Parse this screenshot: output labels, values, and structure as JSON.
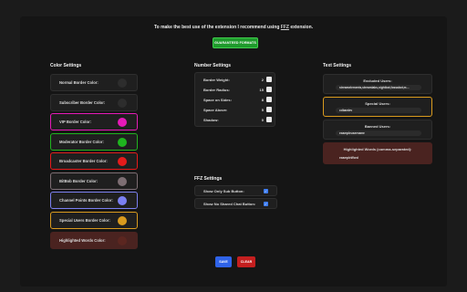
{
  "header": {
    "note_prefix": "To make the best use of the extension I recommend using",
    "note_link": "FFZ",
    "note_suffix": "extension.",
    "generate_button": "GUARANTEED FORMATS"
  },
  "color_settings": {
    "title": "Color Settings",
    "rows": [
      {
        "label": "Normal Border Color:",
        "color": "#2d2d2d",
        "border": "#2e2e2e",
        "bg": "#1f1f1f"
      },
      {
        "label": "Subscriber Border Color:",
        "color": "#2d2d2d",
        "border": "#2e2e2e",
        "bg": "#1f1f1f"
      },
      {
        "label": "VIP Border Color:",
        "color": "#e619b8",
        "border": "#e619b8",
        "bg": "#1f1f1f"
      },
      {
        "label": "Moderator Border Color:",
        "color": "#1fb51f",
        "border": "#1fb51f",
        "bg": "#1f1f1f"
      },
      {
        "label": "Broadcaster Border Color:",
        "color": "#e51b1b",
        "border": "#e51b1b",
        "bg": "#1f1f1f"
      },
      {
        "label": "BitBob Border Color:",
        "color": "#7d6e73",
        "border": "#7d6e73",
        "bg": "#1f1f1f"
      },
      {
        "label": "Channel Points Border Color:",
        "color": "#7b80f2",
        "border": "#7b80f2",
        "bg": "#1f1f1f"
      },
      {
        "label": "Special Users Border Color:",
        "color": "#d99a1e",
        "border": "#d99a1e",
        "bg": "#1f1f1f"
      },
      {
        "label": "Highlighted Words Color:",
        "color": "#5b2620",
        "border": "#4a2320",
        "bg": "#4a2320"
      }
    ]
  },
  "number_settings": {
    "title": "Number Settings",
    "rows": [
      {
        "label": "Border Weight:",
        "value": "2"
      },
      {
        "label": "Border Radius:",
        "value": "15"
      },
      {
        "label": "Space on Sides:",
        "value": "8"
      },
      {
        "label": "Space Above:",
        "value": "5"
      },
      {
        "label": "Shadow:",
        "value": "0"
      }
    ]
  },
  "text_settings": {
    "title": "Text Settings",
    "cards": [
      {
        "label": "Excluded Users:",
        "value": "streamelements,streamlabs,nightbot,fossabot,m…",
        "border": "#2e2e2e",
        "bg": "#1f1f1f"
      },
      {
        "label": "Special Users:",
        "value": "cdbardev",
        "border": "#d99a1e",
        "bg": "#1f1f1f"
      },
      {
        "label": "Banned Users:",
        "value": "exampleusername",
        "border": "#2e2e2e",
        "bg": "#1f1f1f"
      },
      {
        "label": "Highlighted Words (comma-separated):",
        "value": "exampleWord",
        "border": "#4a2320",
        "bg": "#4a2320"
      }
    ]
  },
  "ffz_settings": {
    "title": "FFZ Settings",
    "rows": [
      {
        "label": "Show Only Sub Button:",
        "checked": "✓"
      },
      {
        "label": "Show No Shared Chat Button:",
        "checked": "✓"
      }
    ]
  },
  "actions": {
    "save": "SAVE",
    "clear": "CLEAR"
  }
}
